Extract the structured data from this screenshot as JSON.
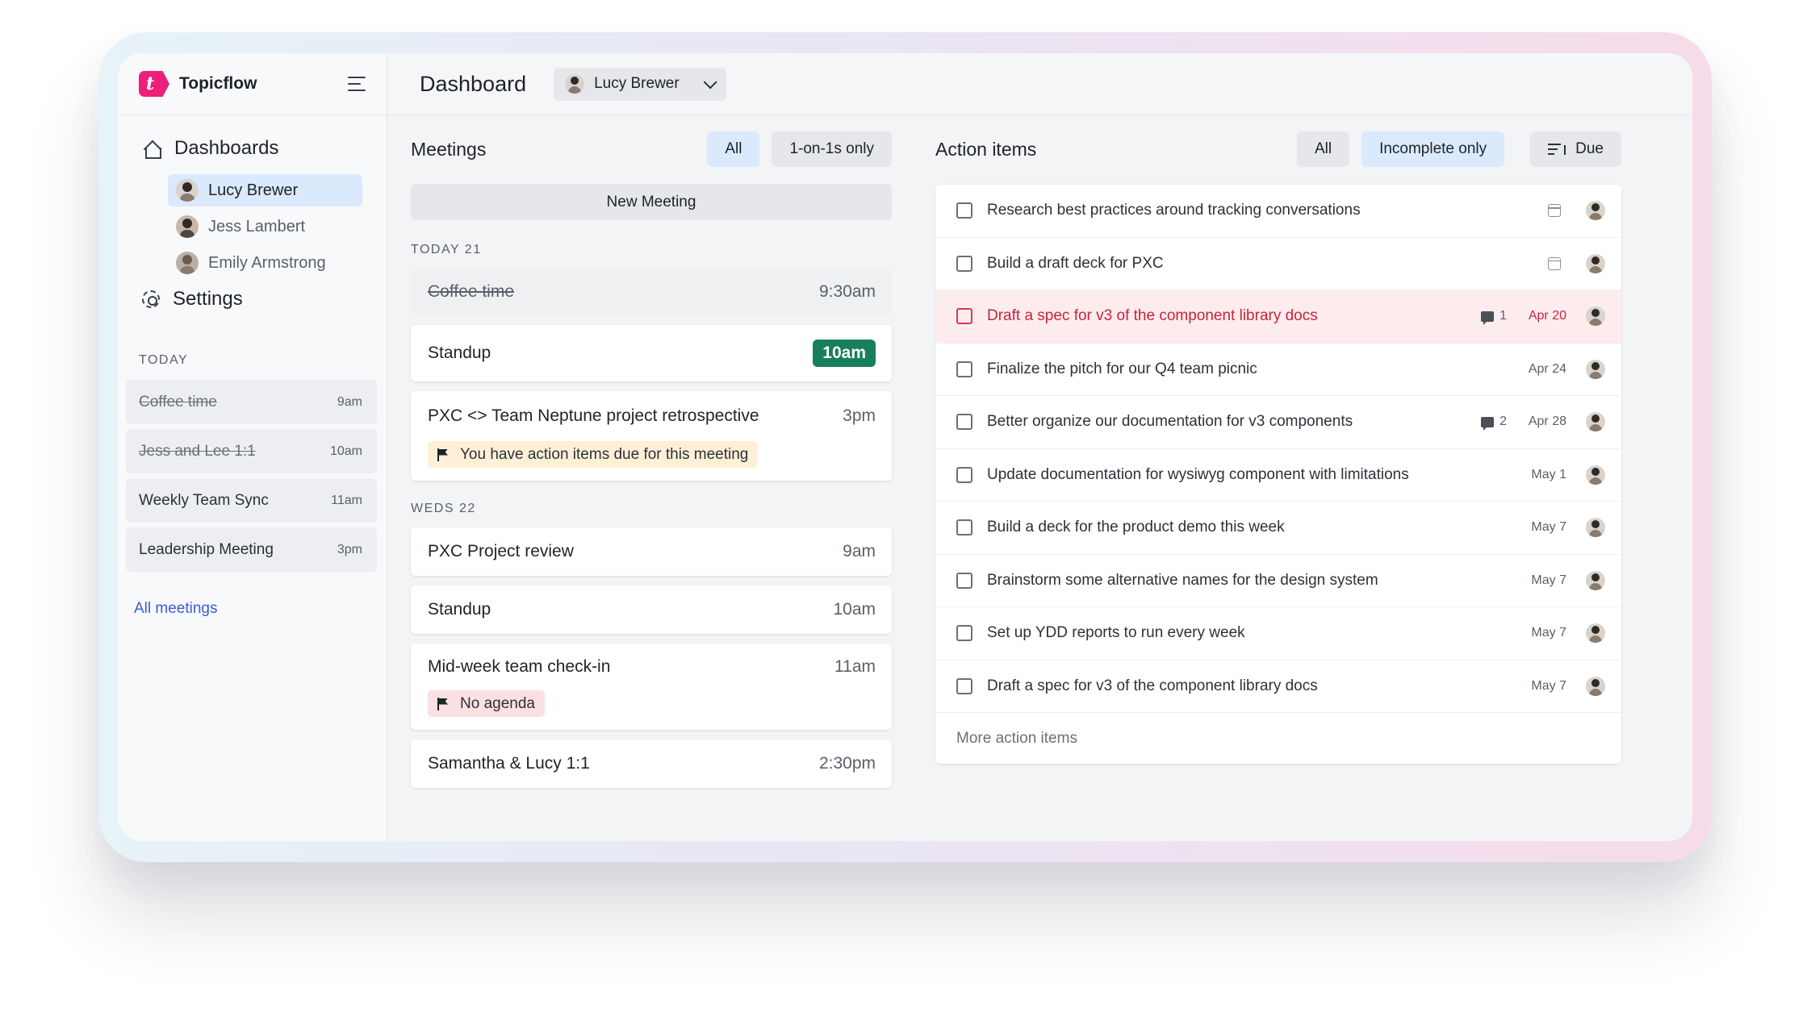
{
  "app": {
    "name": "Topicflow",
    "logo_letter": "t"
  },
  "sidebar": {
    "dashboards_label": "Dashboards",
    "people": [
      {
        "name": "Lucy Brewer",
        "active": true
      },
      {
        "name": "Jess Lambert",
        "active": false
      },
      {
        "name": "Emily Armstrong",
        "active": false
      }
    ],
    "settings_label": "Settings",
    "today_label": "TODAY",
    "meetings": [
      {
        "title": "Coffee time",
        "time": "9am",
        "done": true
      },
      {
        "title": "Jess and Lee 1:1",
        "time": "10am",
        "done": true
      },
      {
        "title": "Weekly Team Sync",
        "time": "11am",
        "done": false
      },
      {
        "title": "Leadership Meeting",
        "time": "3pm",
        "done": false
      }
    ],
    "all_meetings_label": "All meetings"
  },
  "header": {
    "title": "Dashboard",
    "user": "Lucy Brewer"
  },
  "meetings": {
    "title": "Meetings",
    "filter_all": "All",
    "filter_1on1": "1-on-1s only",
    "new_meeting": "New Meeting",
    "today_label": "TODAY 21",
    "today": [
      {
        "title": "Coffee time",
        "time": "9:30am"
      },
      {
        "title": "Standup",
        "time": "10am"
      },
      {
        "title": "PXC <> Team Neptune project retrospective",
        "time": "3pm",
        "note": "You have action items due for this meeting"
      }
    ],
    "weds_label": "WEDS 22",
    "weds": [
      {
        "title": "PXC Project review",
        "time": "9am"
      },
      {
        "title": "Standup",
        "time": "10am"
      },
      {
        "title": "Mid-week team check-in",
        "time": "11am",
        "note": "No agenda"
      },
      {
        "title": "Samantha & Lucy 1:1",
        "time": "2:30pm"
      }
    ]
  },
  "actions": {
    "title": "Action items",
    "filter_all": "All",
    "filter_incomplete": "Incomplete only",
    "sort_label": "Due",
    "items": [
      {
        "text": "Research best practices around tracking conversations",
        "comments": "",
        "due": ""
      },
      {
        "text": "Build a draft deck for PXC",
        "comments": "",
        "due": ""
      },
      {
        "text": "Draft a spec for v3 of the component library docs",
        "comments": "1",
        "due": "Apr 20"
      },
      {
        "text": "Finalize the pitch for our Q4 team picnic",
        "comments": "",
        "due": "Apr 24"
      },
      {
        "text": "Better organize our documentation for v3 components",
        "comments": "2",
        "due": "Apr 28"
      },
      {
        "text": "Update documentation for wysiwyg component with limitations",
        "comments": "",
        "due": "May 1"
      },
      {
        "text": "Build a deck for the product demo this week",
        "comments": "",
        "due": "May 7"
      },
      {
        "text": "Brainstorm some alternative names for the design system",
        "comments": "",
        "due": "May 7"
      },
      {
        "text": "Set up YDD reports to run every week",
        "comments": "",
        "due": "May 7"
      },
      {
        "text": "Draft a spec for v3 of the component library docs",
        "comments": "",
        "due": "May 7"
      }
    ],
    "more_label": "More action items"
  },
  "colors": {
    "brand": "#ec1f7b",
    "accent_bg": "#dbe9fd",
    "success": "#17805a",
    "danger": "#c8243a",
    "link": "#3d5bd9"
  }
}
